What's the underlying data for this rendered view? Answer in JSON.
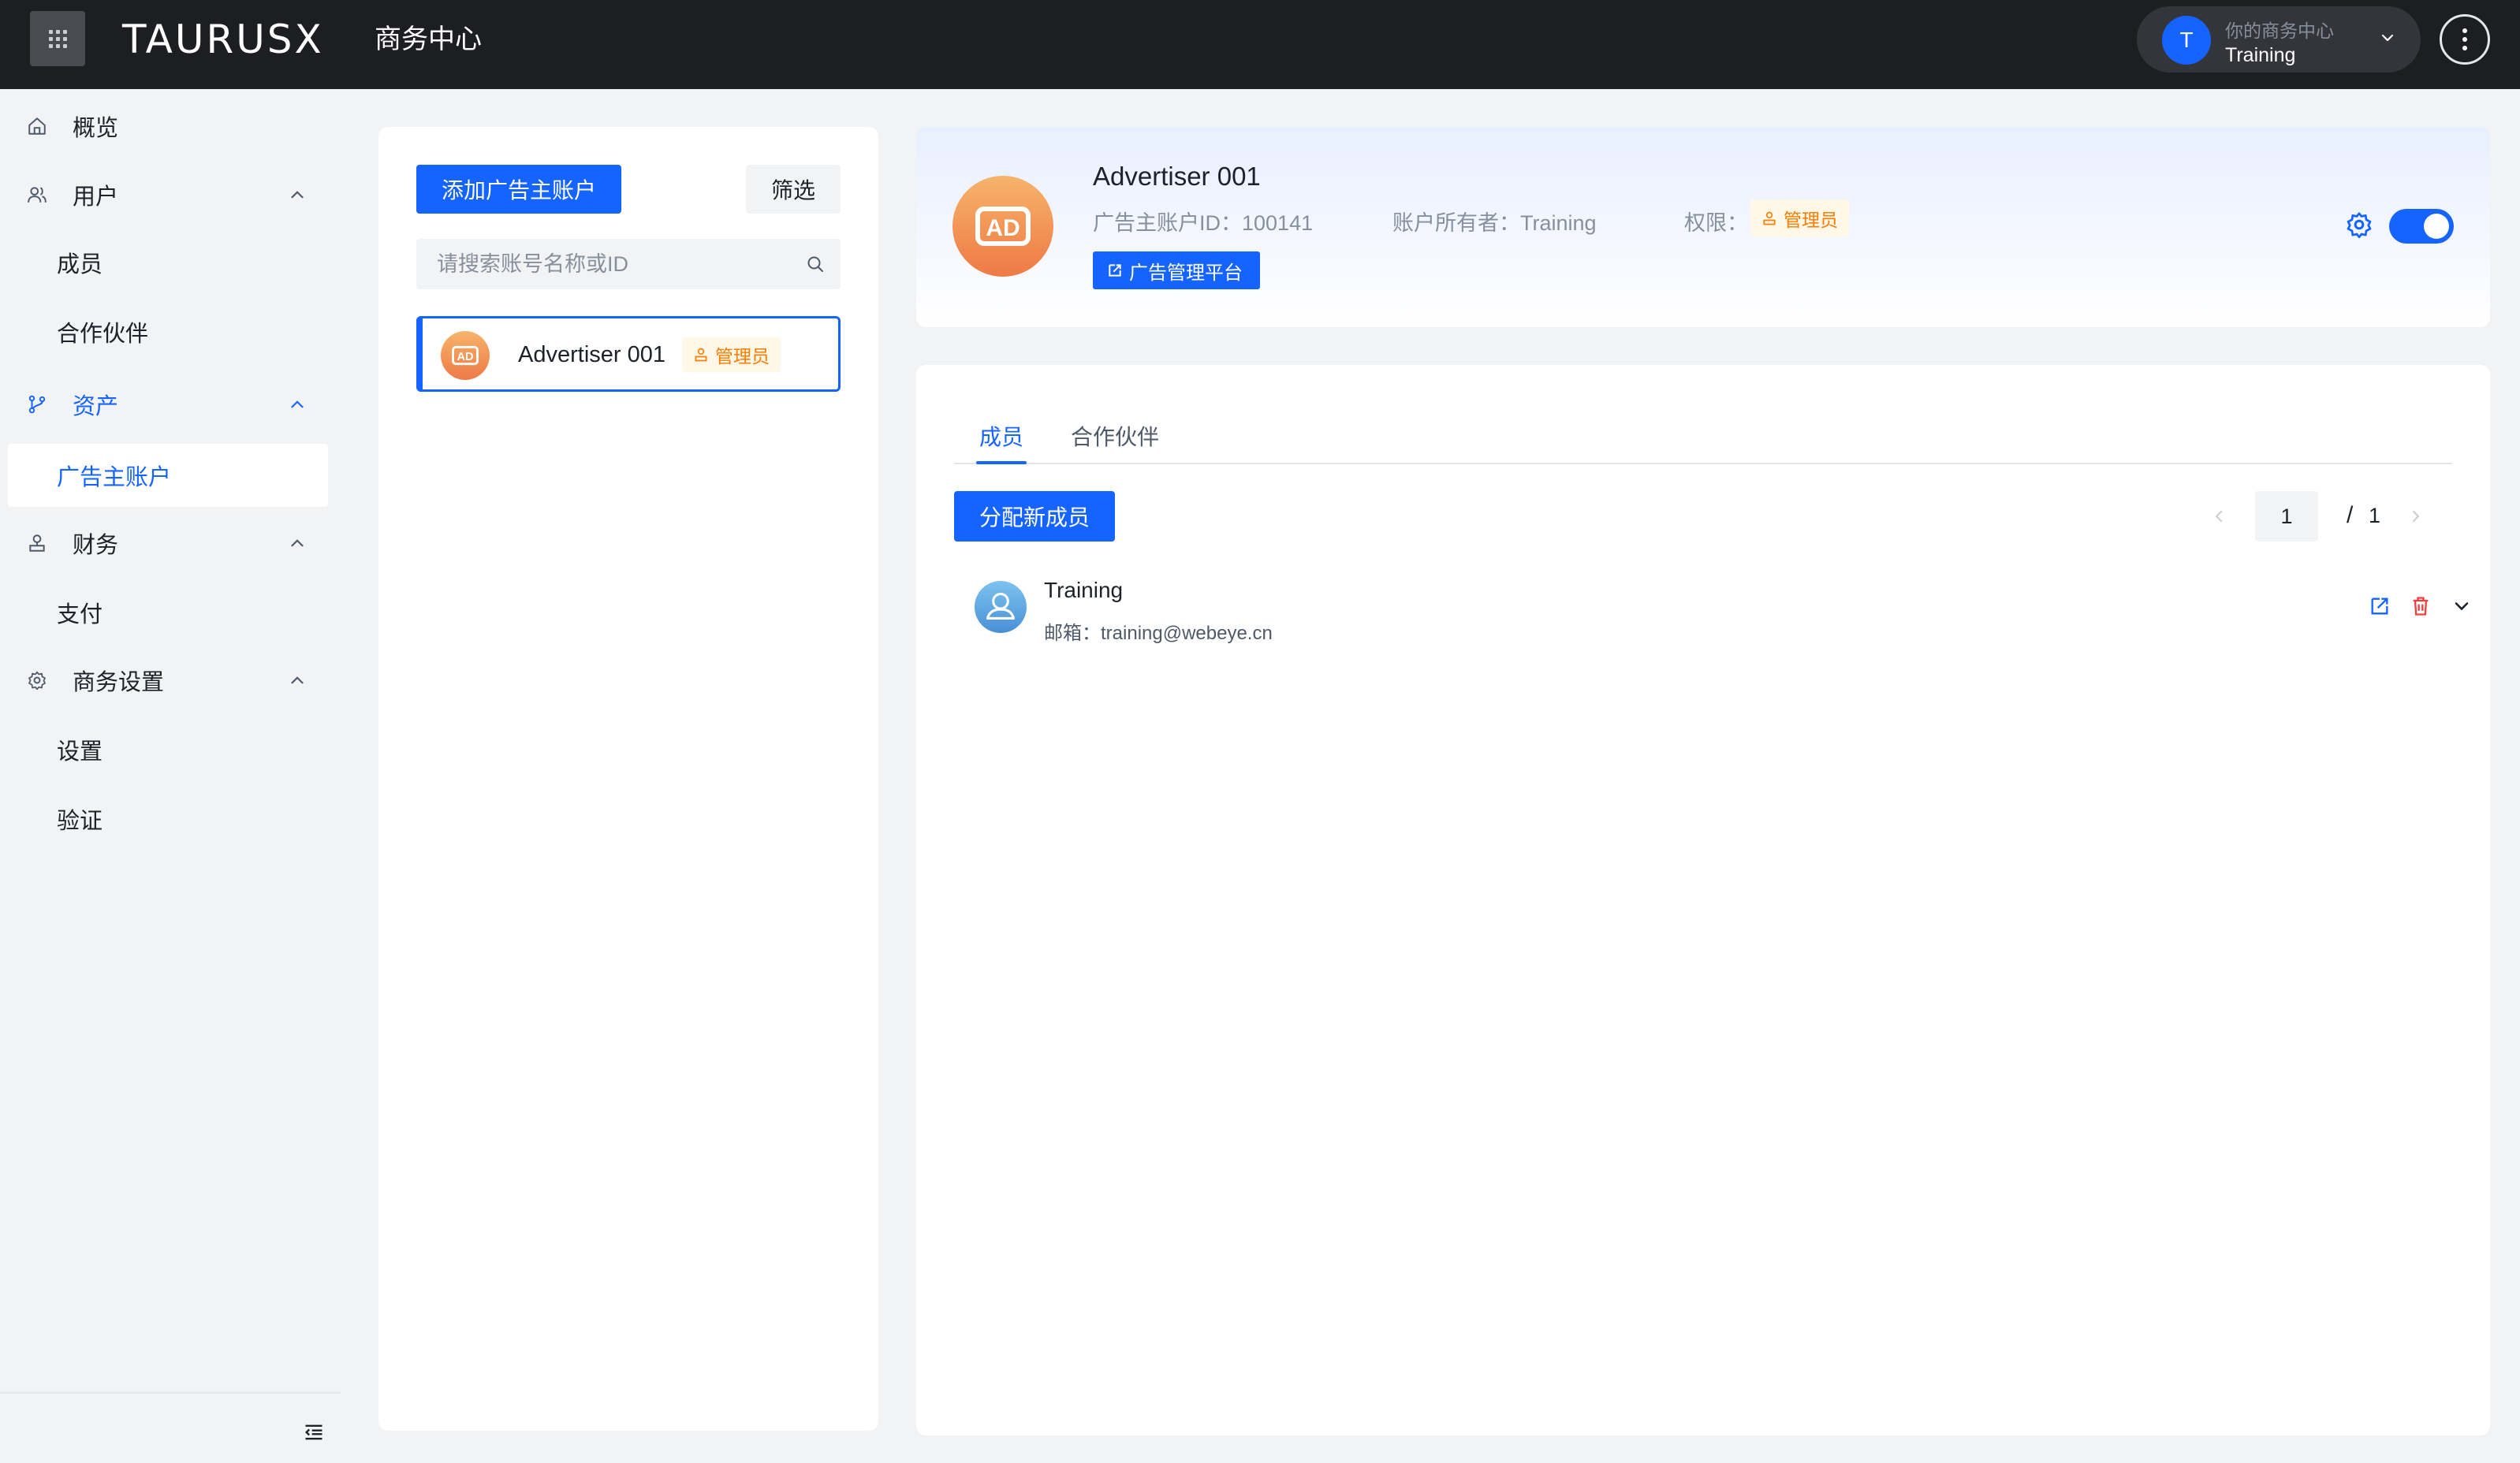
{
  "topbar": {
    "brand": "TAURUSX",
    "brand_sub": "商务中心",
    "business_switch": {
      "avatar_letter": "T",
      "hint": "你的商务中心",
      "name": "Training"
    }
  },
  "sidebar": {
    "items": [
      {
        "label": "概览",
        "icon": "home-icon"
      },
      {
        "label": "用户",
        "icon": "users-icon",
        "expanded": true
      },
      {
        "label": "成员"
      },
      {
        "label": "合作伙伴"
      },
      {
        "label": "资产",
        "icon": "assets-icon",
        "expanded": true
      },
      {
        "label": "广告主账户",
        "selected": true
      },
      {
        "label": "财务",
        "icon": "finance-icon",
        "expanded": true
      },
      {
        "label": "支付"
      },
      {
        "label": "商务设置",
        "icon": "settings-icon",
        "expanded": true
      },
      {
        "label": "设置"
      },
      {
        "label": "验证"
      }
    ]
  },
  "list_panel": {
    "add_button": "添加广告主账户",
    "filter_button": "筛选",
    "search_placeholder": "请搜索账号名称或ID",
    "accounts": [
      {
        "name": "Advertiser 001",
        "role": "管理员",
        "logo_text": "AD"
      }
    ]
  },
  "detail": {
    "title": "Advertiser 001",
    "logo_text": "AD",
    "account_id_label": "广告主账户ID：",
    "account_id": "100141",
    "owner_label": "账户所有者：",
    "owner": "Training",
    "perm_label": "权限：",
    "perm": "管理员",
    "platform_button": "广告管理平台",
    "enabled": true
  },
  "members": {
    "tabs": [
      "成员",
      "合作伙伴"
    ],
    "active_tab": "成员",
    "assign_button": "分配新成员",
    "pagination": {
      "current": "1",
      "separator": "/",
      "total": "1"
    },
    "rows": [
      {
        "name": "Training",
        "email_label": "邮箱：",
        "email": "training@webeye.cn"
      }
    ]
  },
  "colors": {
    "primary": "#1664ff",
    "topbar": "#1d1e22",
    "admin_tag_bg": "#fff7e8",
    "admin_tag_fg": "#ff7d00",
    "delete": "#f53f3f",
    "ad_logo": "#f08a4b"
  }
}
